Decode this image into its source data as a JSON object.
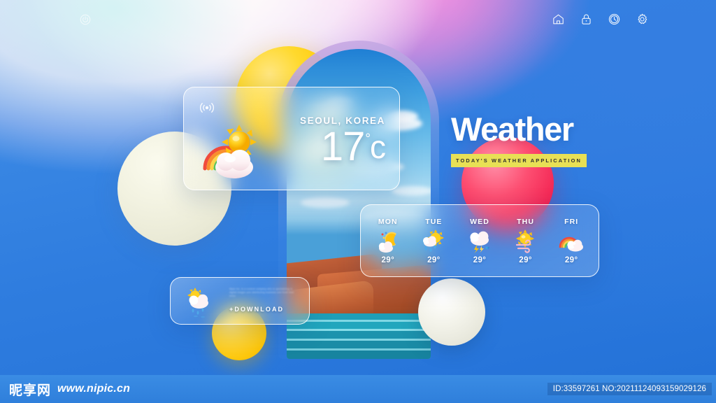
{
  "nav": {
    "power_icon": "power-icon",
    "icons": [
      {
        "name": "home-icon",
        "label": "Home"
      },
      {
        "name": "lock-icon",
        "label": "Lock"
      },
      {
        "name": "clock-icon",
        "label": "Clock"
      },
      {
        "name": "gear-icon",
        "label": "Settings"
      }
    ]
  },
  "headline": {
    "title": "Weather",
    "subtitle": "TODAY'S WEATHER APPLICATION",
    "banner_color": "#e8e055"
  },
  "current": {
    "signal_icon": "broadcast-signal-icon",
    "weather_icon": "sun-rainbow-cloud-icon",
    "city": "SEOUL, KOREA",
    "temperature": "17",
    "degree_symbol": "°",
    "unit": "c"
  },
  "forecast": {
    "days": [
      {
        "label": "MON",
        "icon": "moon-cloud-icon",
        "temp": "29°"
      },
      {
        "label": "TUE",
        "icon": "sun-rain-icon",
        "temp": "29°"
      },
      {
        "label": "WED",
        "icon": "cloud-lightning-icon",
        "temp": "29°"
      },
      {
        "label": "THU",
        "icon": "sun-wind-icon",
        "temp": "29°"
      },
      {
        "label": "FRI",
        "icon": "rainbow-cloud-icon",
        "temp": "29°"
      }
    ]
  },
  "download": {
    "icon": "sun-cloud-rain-icon",
    "blurb": "Nipic Inc. is a content company who is specializing in digital images and distributing business and fresh ever since.",
    "button_label": "+DOWNLOAD"
  },
  "watermark": {
    "logo": "昵享网",
    "url": "www.nipic.cn",
    "id": "ID:33597261 NO:20211124093159029126"
  },
  "colors": {
    "background_blue": "#2f7fe0",
    "accent_yellow": "#ffd92e",
    "accent_pink": "#f42a57",
    "banner_yellow": "#e8e055"
  }
}
